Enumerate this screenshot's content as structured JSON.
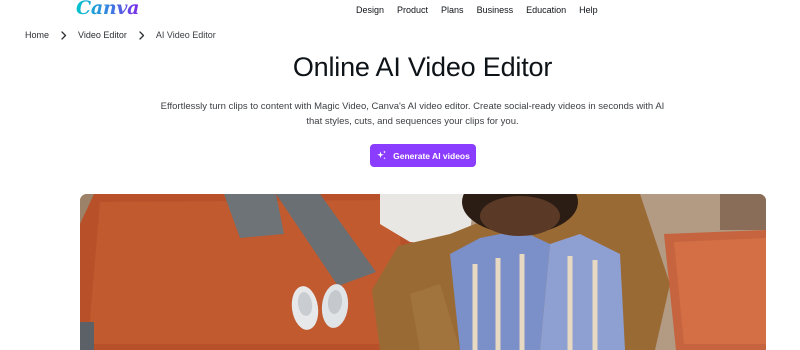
{
  "header": {
    "logo_text": "Canva",
    "nav": [
      "Design",
      "Product",
      "Plans",
      "Business",
      "Education",
      "Help"
    ]
  },
  "breadcrumb": {
    "items": [
      "Home",
      "Video Editor"
    ],
    "current": "AI Video Editor"
  },
  "hero": {
    "title": "Online AI Video Editor",
    "description": "Effortlessly turn clips to content with Magic Video, Canva's AI video editor. Create social-ready videos in seconds with AI that styles, cuts, and sequences your clips for you.",
    "cta_label": "Generate AI videos",
    "cta_icon": "sparkle-icon"
  },
  "colors": {
    "accent": "#8b3dff",
    "logo_gradient": [
      "#00c4cc",
      "#7d2ae8"
    ]
  }
}
